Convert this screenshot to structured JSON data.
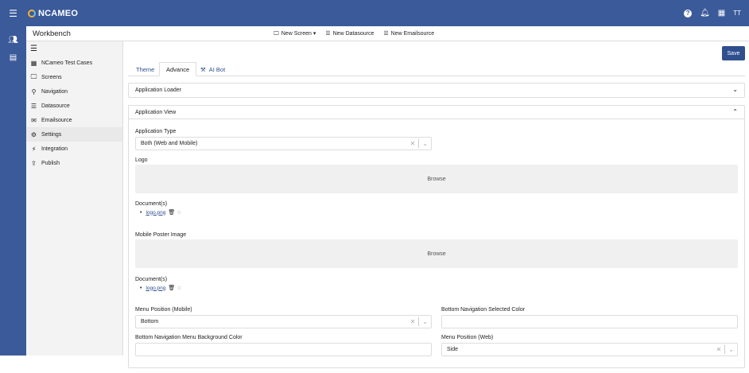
{
  "app": {
    "brand": "NCAMEO",
    "avatar_initials": "TT"
  },
  "header": {
    "title": "Workbench",
    "actions": [
      {
        "icon": "monitor-icon",
        "label": "New Screen ▾"
      },
      {
        "icon": "database-icon",
        "label": "New Datasource"
      },
      {
        "icon": "database-icon",
        "label": "New Emailsource"
      }
    ]
  },
  "sidebar": {
    "items": [
      {
        "icon": "table-icon",
        "label": "NCameo Test Cases"
      },
      {
        "icon": "monitor-icon",
        "label": "Screens"
      },
      {
        "icon": "sitemap-icon",
        "label": "Navigation"
      },
      {
        "icon": "database-icon",
        "label": "Datasource"
      },
      {
        "icon": "envelope-icon",
        "label": "Emailsource"
      },
      {
        "icon": "gear-icon",
        "label": "Settings",
        "active": true
      },
      {
        "icon": "plug-icon",
        "label": "Integration"
      },
      {
        "icon": "upload-icon",
        "label": "Publish"
      }
    ]
  },
  "main": {
    "save_label": "Save",
    "tabs": [
      {
        "label": "Theme"
      },
      {
        "label": "Advance",
        "active": true
      },
      {
        "label": "AI Bot"
      }
    ],
    "sections": {
      "loader": {
        "title": "Application Loader",
        "expanded": false
      },
      "view": {
        "title": "Application View",
        "expanded": true
      }
    },
    "form": {
      "app_type_label": "Application Type",
      "app_type_value": "Both (Web and Mobile)",
      "logo_label": "Logo",
      "browse_label": "Browse",
      "documents_label": "Document(s)",
      "logo_file": "logo.png",
      "poster_label": "Mobile Poster Image",
      "poster_browse_label": "Browse",
      "poster_documents_label": "Document(s)",
      "poster_file": "logo.png",
      "menu_mobile_label": "Menu Position (Mobile)",
      "menu_mobile_value": "Bottom",
      "bottom_nav_selected_label": "Bottom Navigation Selected Color",
      "bottom_nav_bg_label": "Bottom Navigation Menu Background Color",
      "menu_web_label": "Menu Position (Web)",
      "menu_web_value": "Side"
    }
  }
}
